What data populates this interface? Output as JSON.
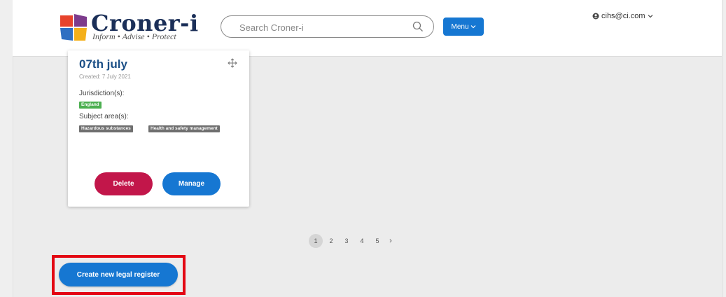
{
  "header": {
    "logo_name": "Croner-i",
    "logo_tagline": "Inform • Advise • Protect",
    "search_placeholder": "Search Croner-i",
    "menu_label": "Menu",
    "user_email": "cihs@ci.com"
  },
  "card": {
    "title": "07th july",
    "created": "Created: 7 July 2021",
    "jurisdictions_label": "Jurisdiction(s):",
    "jurisdictions": [
      "England"
    ],
    "subject_areas_label": "Subject area(s):",
    "subject_areas": [
      "Hazardous substances",
      "Health and safety management"
    ],
    "delete_label": "Delete",
    "manage_label": "Manage"
  },
  "pagination": {
    "pages": [
      "1",
      "2",
      "3",
      "4",
      "5"
    ],
    "current": "1",
    "next_symbol": "›"
  },
  "create_button_label": "Create new legal register",
  "colors": {
    "primary_blue": "#1677d2",
    "delete_red": "#c2164a",
    "jurisdiction_green": "#4caf50",
    "subject_grey": "#6f6f6f",
    "highlight_red": "#e30613"
  }
}
